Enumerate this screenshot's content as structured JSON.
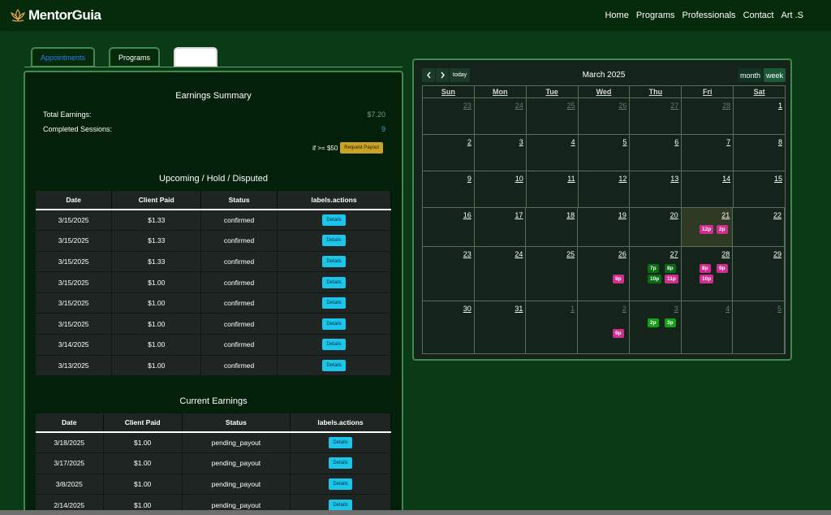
{
  "brand": {
    "name": "MentorGuia"
  },
  "nav": {
    "links": [
      "Home",
      "Programs",
      "Professionals",
      "Contact",
      "Art .S"
    ]
  },
  "tabs": [
    "Appointments",
    "Programs",
    ""
  ],
  "summary": {
    "title": "Earnings Summary",
    "total_label": "Total Earnings:",
    "total_value": "$7.20",
    "sessions_label": "Completed Sessions:",
    "sessions_value": "9",
    "payout_condition": "if >= $50",
    "payout_button": "Request Payout"
  },
  "upcoming": {
    "title": "Upcoming / Hold / Disputed",
    "headers": [
      "Date",
      "Client Paid",
      "Status",
      "labels.actions"
    ],
    "rows": [
      [
        "3/15/2025",
        "$1.33",
        "confirmed",
        "Details"
      ],
      [
        "3/15/2025",
        "$1.33",
        "confirmed",
        "Details"
      ],
      [
        "3/15/2025",
        "$1.33",
        "confirmed",
        "Details"
      ],
      [
        "3/15/2025",
        "$1.00",
        "confirmed",
        "Details"
      ],
      [
        "3/15/2025",
        "$1.00",
        "confirmed",
        "Details"
      ],
      [
        "3/15/2025",
        "$1.00",
        "confirmed",
        "Details"
      ],
      [
        "3/14/2025",
        "$1.00",
        "confirmed",
        "Details"
      ],
      [
        "3/13/2025",
        "$1.00",
        "confirmed",
        "Details"
      ]
    ]
  },
  "current": {
    "title": "Current Earnings",
    "headers": [
      "Date",
      "Client Paid",
      "Status",
      "labels.actions"
    ],
    "rows": [
      [
        "3/18/2025",
        "$1.00",
        "pending_payout",
        "Details"
      ],
      [
        "3/17/2025",
        "$1.00",
        "pending_payout",
        "Details"
      ],
      [
        "3/8/2025",
        "$1.00",
        "pending_payout",
        "Details"
      ],
      [
        "2/14/2025",
        "$1.00",
        "pending_payout",
        "Details"
      ]
    ]
  },
  "calendar": {
    "title": "March 2025",
    "today_label": "today",
    "prev_icon": "chevron-left-icon",
    "next_icon": "chevron-right-icon",
    "views": [
      "month",
      "week"
    ],
    "active_view": "week",
    "weekdays": [
      "Sun",
      "Mon",
      "Tue",
      "Wed",
      "Thu",
      "Fri",
      "Sat"
    ],
    "weeks": [
      [
        {
          "d": "23",
          "o": true
        },
        {
          "d": "24",
          "o": true
        },
        {
          "d": "25",
          "o": true
        },
        {
          "d": "26",
          "o": true
        },
        {
          "d": "27",
          "o": true
        },
        {
          "d": "28",
          "o": true
        },
        {
          "d": "1"
        }
      ],
      [
        {
          "d": "2"
        },
        {
          "d": "3"
        },
        {
          "d": "4"
        },
        {
          "d": "5"
        },
        {
          "d": "6"
        },
        {
          "d": "7"
        },
        {
          "d": "8"
        }
      ],
      [
        {
          "d": "9"
        },
        {
          "d": "10"
        },
        {
          "d": "11"
        },
        {
          "d": "12"
        },
        {
          "d": "13"
        },
        {
          "d": "14"
        },
        {
          "d": "15"
        }
      ],
      [
        {
          "d": "16"
        },
        {
          "d": "17"
        },
        {
          "d": "18"
        },
        {
          "d": "19"
        },
        {
          "d": "20"
        },
        {
          "d": "21",
          "today": true
        },
        {
          "d": "22"
        }
      ],
      [
        {
          "d": "23"
        },
        {
          "d": "24"
        },
        {
          "d": "25"
        },
        {
          "d": "26"
        },
        {
          "d": "27"
        },
        {
          "d": "28"
        },
        {
          "d": "29"
        }
      ],
      [
        {
          "d": "30"
        },
        {
          "d": "31"
        },
        {
          "d": "1",
          "o": true
        },
        {
          "d": "2",
          "o": true
        },
        {
          "d": "3",
          "o": true
        },
        {
          "d": "4",
          "o": true
        },
        {
          "d": "5",
          "o": true
        }
      ]
    ],
    "events": [
      {
        "week": 3,
        "col": 5,
        "slot": 0,
        "label": "12p",
        "color": "pink"
      },
      {
        "week": 3,
        "col": 5,
        "slot": 1,
        "label": "2p",
        "color": "pink"
      },
      {
        "week": 4,
        "col": 4,
        "slot": 0,
        "label": "7p",
        "color": "dark",
        "row": 0
      },
      {
        "week": 4,
        "col": 4,
        "slot": 1,
        "label": "8p",
        "color": "dark",
        "row": 0
      },
      {
        "week": 4,
        "col": 5,
        "slot": 0,
        "label": "8p",
        "color": "pink",
        "row": 0
      },
      {
        "week": 4,
        "col": 5,
        "slot": 1,
        "label": "9p",
        "color": "pink",
        "row": 0
      },
      {
        "week": 4,
        "col": 3,
        "slot": 1,
        "label": "9p",
        "color": "pink",
        "row": 1
      },
      {
        "week": 4,
        "col": 4,
        "slot": 0,
        "label": "10p",
        "color": "dark",
        "row": 1
      },
      {
        "week": 4,
        "col": 4,
        "slot": 1,
        "label": "11p",
        "color": "pink",
        "row": 1
      },
      {
        "week": 4,
        "col": 5,
        "slot": 0,
        "label": "10p",
        "color": "pink",
        "row": 1
      },
      {
        "week": 5,
        "col": 4,
        "slot": 0,
        "label": "2p",
        "color": "green",
        "row": 0
      },
      {
        "week": 5,
        "col": 4,
        "slot": 1,
        "label": "3p",
        "color": "green",
        "row": 0
      },
      {
        "week": 5,
        "col": 3,
        "slot": 1,
        "label": "9p",
        "color": "pink",
        "row": 1
      }
    ]
  },
  "colors": {
    "accent_blue": "#2e7cf6",
    "details_btn": "#1ec5ea",
    "payout_btn": "#c9a227",
    "event_pink": "#d12c8f",
    "event_green": "#13a116"
  }
}
